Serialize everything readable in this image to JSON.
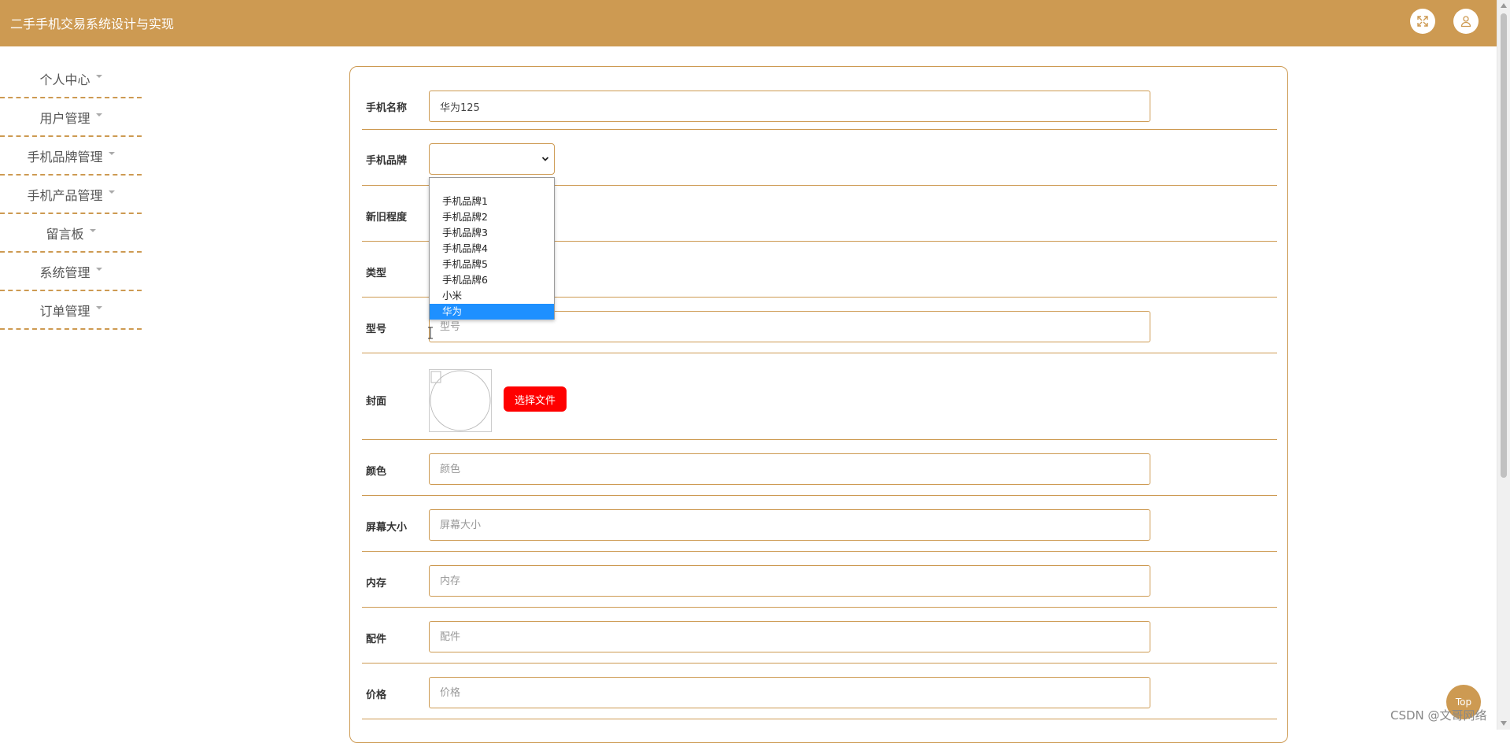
{
  "header": {
    "title": "二手手机交易系统设计与实现",
    "fullscreen_icon": "expand-icon",
    "user_icon": "user-icon",
    "bg_color": "#cd9a52"
  },
  "sidebar": {
    "items": [
      {
        "label": "个人中心"
      },
      {
        "label": "用户管理"
      },
      {
        "label": "手机品牌管理"
      },
      {
        "label": "手机产品管理"
      },
      {
        "label": "留言板"
      },
      {
        "label": "系统管理"
      },
      {
        "label": "订单管理"
      }
    ]
  },
  "form": {
    "name": {
      "label": "手机名称",
      "value": "华为125"
    },
    "brand": {
      "label": "手机品牌",
      "value": "",
      "options": [
        "",
        "手机品牌1",
        "手机品牌2",
        "手机品牌3",
        "手机品牌4",
        "手机品牌5",
        "手机品牌6",
        "小米",
        "华为"
      ],
      "highlighted": "华为"
    },
    "condition": {
      "label": "新旧程度"
    },
    "type": {
      "label": "类型"
    },
    "model": {
      "label": "型号",
      "placeholder": "型号"
    },
    "cover": {
      "label": "封面",
      "button": "选择文件"
    },
    "color": {
      "label": "颜色",
      "placeholder": "颜色"
    },
    "screen": {
      "label": "屏幕大小",
      "placeholder": "屏幕大小"
    },
    "memory": {
      "label": "内存",
      "placeholder": "内存"
    },
    "accessories": {
      "label": "配件",
      "placeholder": "配件"
    },
    "price": {
      "label": "价格",
      "placeholder": "价格"
    }
  },
  "back_to_top": "Top",
  "watermark": "CSDN @文哥网络"
}
